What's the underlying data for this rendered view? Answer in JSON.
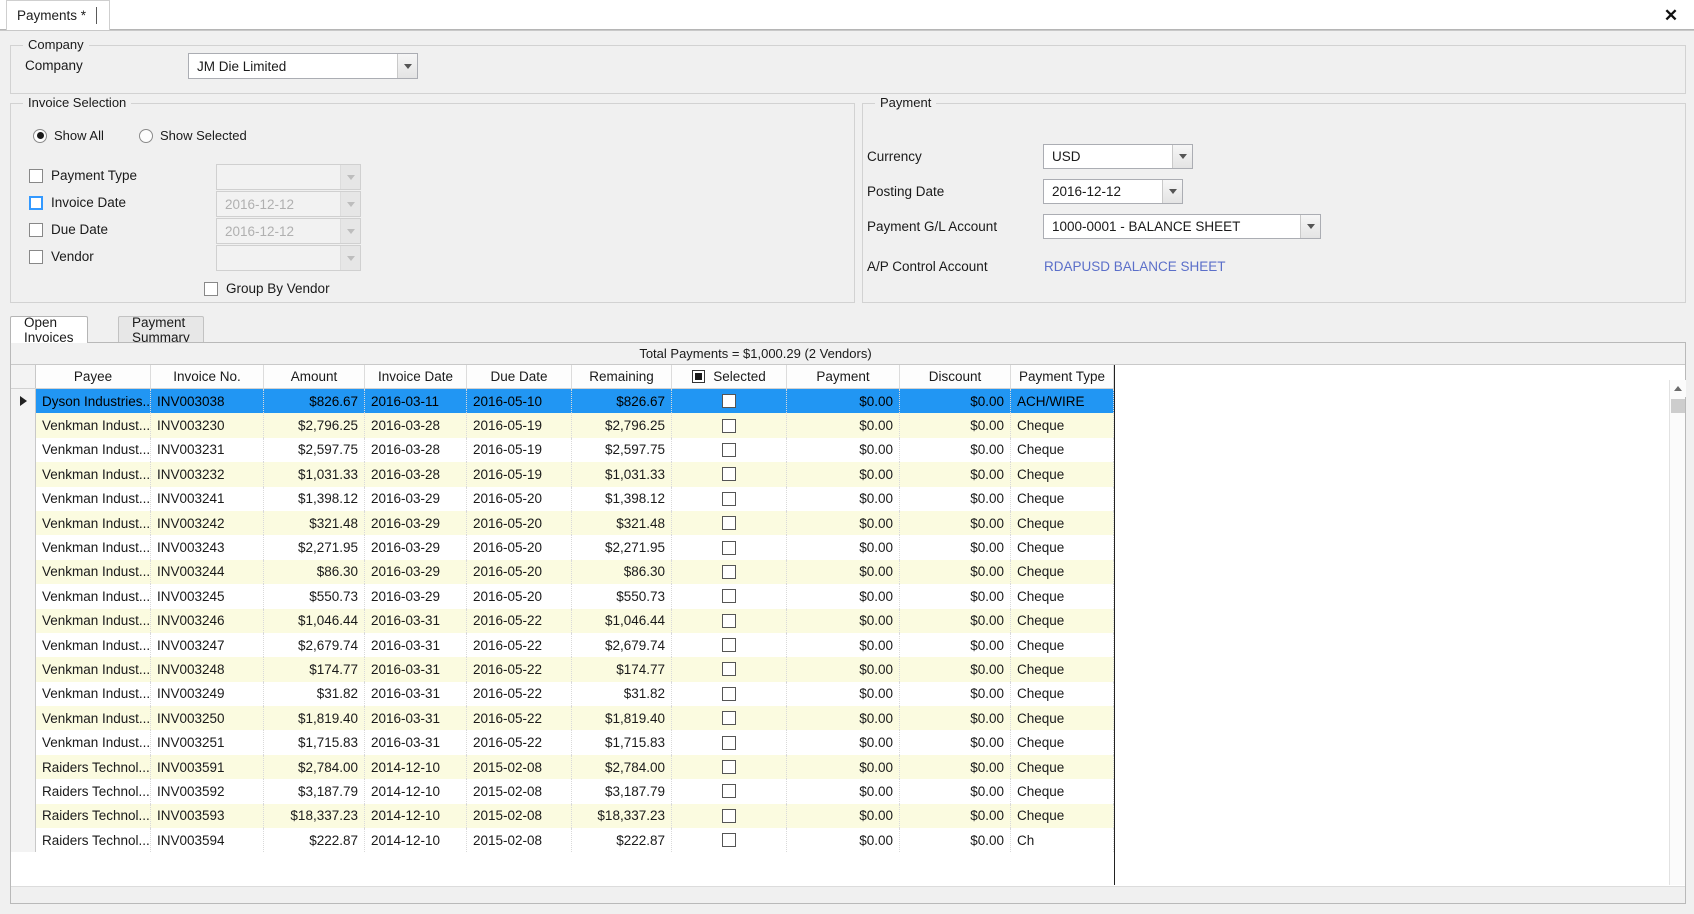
{
  "window": {
    "tab_label": "Payments *",
    "close_icon": "close-icon"
  },
  "company_section": {
    "group_title": "Company",
    "company_label": "Company",
    "company_value": "JM Die Limited"
  },
  "invoice_selection": {
    "group_title": "Invoice Selection",
    "radios": [
      {
        "label": "Show All",
        "selected": true
      },
      {
        "label": "Show Selected",
        "selected": false
      }
    ],
    "filters": [
      {
        "label": "Payment Type",
        "checked": false,
        "focused": false,
        "value": "",
        "disabled": true
      },
      {
        "label": "Invoice Date",
        "checked": false,
        "focused": true,
        "value": "2016-12-12",
        "disabled": true
      },
      {
        "label": "Due Date",
        "checked": false,
        "focused": false,
        "value": "2016-12-12",
        "disabled": true
      },
      {
        "label": "Vendor",
        "checked": false,
        "focused": false,
        "value": "",
        "disabled": true
      }
    ],
    "group_by_vendor_label": "Group By Vendor",
    "group_by_vendor_checked": false
  },
  "payment_section": {
    "group_title": "Payment",
    "currency_label": "Currency",
    "currency_value": "USD",
    "posting_date_label": "Posting Date",
    "posting_date_value": "2016-12-12",
    "gl_account_label": "Payment G/L Account",
    "gl_account_value": "1000-0001 - BALANCE SHEET",
    "ap_control_label": "A/P Control Account",
    "ap_control_value": "RDAPUSD BALANCE SHEET",
    "ap_control_color": "#5b6fc9"
  },
  "tabs": [
    {
      "label": "Open Invoices",
      "active": true
    },
    {
      "label": "Payment Summary",
      "active": false
    }
  ],
  "grid": {
    "total_text": "Total Payments = $1,000.29 (2 Vendors)",
    "columns": [
      "Payee",
      "Invoice No.",
      "Amount",
      "Invoice Date",
      "Due Date",
      "Remaining",
      "Selected",
      "Payment",
      "Discount",
      "Payment Type"
    ],
    "select_all_header_icon": "checkbox-partial-icon",
    "rows": [
      {
        "payee": "Dyson Industries...",
        "invoice_no": "INV003038",
        "amount": "$826.67",
        "invoice_date": "2016-03-11",
        "due_date": "2016-05-10",
        "remaining": "$826.67",
        "selected": false,
        "payment": "$0.00",
        "discount": "$0.00",
        "payment_type": "ACH/WIRE",
        "highlighted": true,
        "current": true
      },
      {
        "payee": "Venkman  Indust...",
        "invoice_no": "INV003230",
        "amount": "$2,796.25",
        "invoice_date": "2016-03-28",
        "due_date": "2016-05-19",
        "remaining": "$2,796.25",
        "selected": false,
        "payment": "$0.00",
        "discount": "$0.00",
        "payment_type": "Cheque"
      },
      {
        "payee": "Venkman  Indust...",
        "invoice_no": "INV003231",
        "amount": "$2,597.75",
        "invoice_date": "2016-03-28",
        "due_date": "2016-05-19",
        "remaining": "$2,597.75",
        "selected": false,
        "payment": "$0.00",
        "discount": "$0.00",
        "payment_type": "Cheque"
      },
      {
        "payee": "Venkman  Indust...",
        "invoice_no": "INV003232",
        "amount": "$1,031.33",
        "invoice_date": "2016-03-28",
        "due_date": "2016-05-19",
        "remaining": "$1,031.33",
        "selected": false,
        "payment": "$0.00",
        "discount": "$0.00",
        "payment_type": "Cheque"
      },
      {
        "payee": "Venkman  Indust...",
        "invoice_no": "INV003241",
        "amount": "$1,398.12",
        "invoice_date": "2016-03-29",
        "due_date": "2016-05-20",
        "remaining": "$1,398.12",
        "selected": false,
        "payment": "$0.00",
        "discount": "$0.00",
        "payment_type": "Cheque"
      },
      {
        "payee": "Venkman  Indust...",
        "invoice_no": "INV003242",
        "amount": "$321.48",
        "invoice_date": "2016-03-29",
        "due_date": "2016-05-20",
        "remaining": "$321.48",
        "selected": false,
        "payment": "$0.00",
        "discount": "$0.00",
        "payment_type": "Cheque"
      },
      {
        "payee": "Venkman  Indust...",
        "invoice_no": "INV003243",
        "amount": "$2,271.95",
        "invoice_date": "2016-03-29",
        "due_date": "2016-05-20",
        "remaining": "$2,271.95",
        "selected": false,
        "payment": "$0.00",
        "discount": "$0.00",
        "payment_type": "Cheque"
      },
      {
        "payee": "Venkman  Indust...",
        "invoice_no": "INV003244",
        "amount": "$86.30",
        "invoice_date": "2016-03-29",
        "due_date": "2016-05-20",
        "remaining": "$86.30",
        "selected": false,
        "payment": "$0.00",
        "discount": "$0.00",
        "payment_type": "Cheque"
      },
      {
        "payee": "Venkman  Indust...",
        "invoice_no": "INV003245",
        "amount": "$550.73",
        "invoice_date": "2016-03-29",
        "due_date": "2016-05-20",
        "remaining": "$550.73",
        "selected": false,
        "payment": "$0.00",
        "discount": "$0.00",
        "payment_type": "Cheque"
      },
      {
        "payee": "Venkman  Indust...",
        "invoice_no": "INV003246",
        "amount": "$1,046.44",
        "invoice_date": "2016-03-31",
        "due_date": "2016-05-22",
        "remaining": "$1,046.44",
        "selected": false,
        "payment": "$0.00",
        "discount": "$0.00",
        "payment_type": "Cheque"
      },
      {
        "payee": "Venkman  Indust...",
        "invoice_no": "INV003247",
        "amount": "$2,679.74",
        "invoice_date": "2016-03-31",
        "due_date": "2016-05-22",
        "remaining": "$2,679.74",
        "selected": false,
        "payment": "$0.00",
        "discount": "$0.00",
        "payment_type": "Cheque"
      },
      {
        "payee": "Venkman  Indust...",
        "invoice_no": "INV003248",
        "amount": "$174.77",
        "invoice_date": "2016-03-31",
        "due_date": "2016-05-22",
        "remaining": "$174.77",
        "selected": false,
        "payment": "$0.00",
        "discount": "$0.00",
        "payment_type": "Cheque"
      },
      {
        "payee": "Venkman  Indust...",
        "invoice_no": "INV003249",
        "amount": "$31.82",
        "invoice_date": "2016-03-31",
        "due_date": "2016-05-22",
        "remaining": "$31.82",
        "selected": false,
        "payment": "$0.00",
        "discount": "$0.00",
        "payment_type": "Cheque"
      },
      {
        "payee": "Venkman  Indust...",
        "invoice_no": "INV003250",
        "amount": "$1,819.40",
        "invoice_date": "2016-03-31",
        "due_date": "2016-05-22",
        "remaining": "$1,819.40",
        "selected": false,
        "payment": "$0.00",
        "discount": "$0.00",
        "payment_type": "Cheque"
      },
      {
        "payee": "Venkman  Indust...",
        "invoice_no": "INV003251",
        "amount": "$1,715.83",
        "invoice_date": "2016-03-31",
        "due_date": "2016-05-22",
        "remaining": "$1,715.83",
        "selected": false,
        "payment": "$0.00",
        "discount": "$0.00",
        "payment_type": "Cheque"
      },
      {
        "payee": "Raiders Technol...",
        "invoice_no": "INV003591",
        "amount": "$2,784.00",
        "invoice_date": "2014-12-10",
        "due_date": "2015-02-08",
        "remaining": "$2,784.00",
        "selected": false,
        "payment": "$0.00",
        "discount": "$0.00",
        "payment_type": "Cheque"
      },
      {
        "payee": "Raiders Technol...",
        "invoice_no": "INV003592",
        "amount": "$3,187.79",
        "invoice_date": "2014-12-10",
        "due_date": "2015-02-08",
        "remaining": "$3,187.79",
        "selected": false,
        "payment": "$0.00",
        "discount": "$0.00",
        "payment_type": "Cheque"
      },
      {
        "payee": "Raiders Technol...",
        "invoice_no": "INV003593",
        "amount": "$18,337.23",
        "invoice_date": "2014-12-10",
        "due_date": "2015-02-08",
        "remaining": "$18,337.23",
        "selected": false,
        "payment": "$0.00",
        "discount": "$0.00",
        "payment_type": "Cheque"
      },
      {
        "payee": "Raiders Technol...",
        "invoice_no": "INV003594",
        "amount": "$222.87",
        "invoice_date": "2014-12-10",
        "due_date": "2015-02-08",
        "remaining": "$222.87",
        "selected": false,
        "payment": "$0.00",
        "discount": "$0.00",
        "payment_type": "Ch"
      }
    ]
  },
  "colors": {
    "selection_blue": "#2196f3",
    "alt_row_yellow": "#fbfbe0",
    "link_blue": "#5b6fc9",
    "window_gray": "#f0f0f0"
  }
}
